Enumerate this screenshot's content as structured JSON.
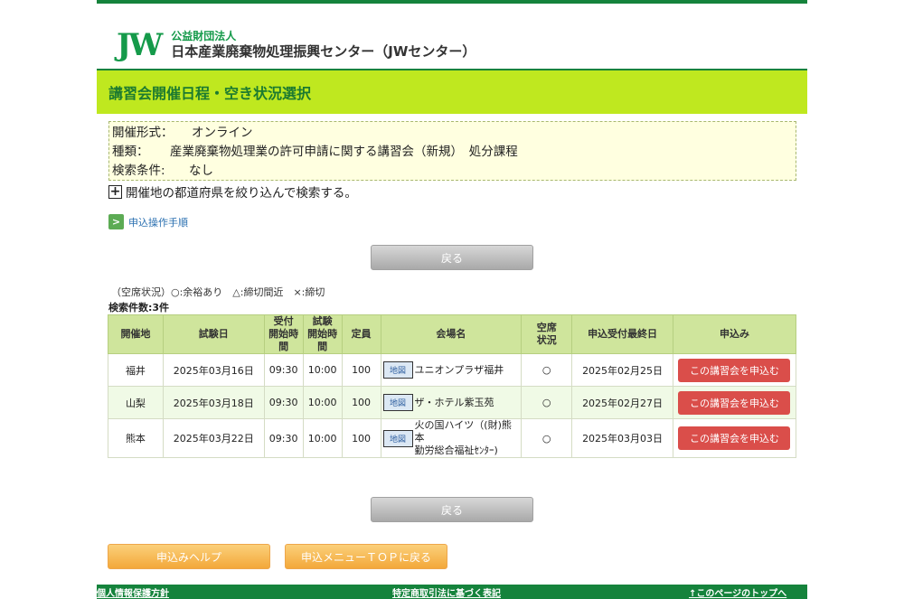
{
  "header": {
    "logo_mark": "JW",
    "logo_sub": "公益財団法人",
    "logo_main": "日本産業廃棄物処理振興センター（JWセンター）",
    "page_title": "講習会開催日程・空き状況選択"
  },
  "info": {
    "format_label": "開催形式：",
    "format_value": "オンライン",
    "type_label": "種類：",
    "type_value": "産業廃棄物処理業の許可申請に関する講習会（新規）　処分課程",
    "search_label": "検索条件:",
    "search_value": "なし"
  },
  "expand_label": "開催地の都道府県を絞り込んで検索する。",
  "help_link": "申込操作手順",
  "back_label": "戻る",
  "legend": "（空席状況）○:余裕あり　△:締切間近　×:締切",
  "result_count": "検索件数:3件",
  "table": {
    "headers": {
      "place": "開催地",
      "date": "試験日",
      "reception_l1": "受付",
      "reception_l2": "開始時間",
      "exam_l1": "試験",
      "exam_l2": "開始時間",
      "capacity": "定員",
      "venue": "会場名",
      "vacancy_l1": "空席",
      "vacancy_l2": "状況",
      "deadline": "申込受付最終日",
      "apply": "申込み"
    },
    "map_label": "地図",
    "apply_label": "この講習会を申込む",
    "rows": [
      {
        "place": "福井",
        "date": "2025年03月16日",
        "reception": "09:30",
        "exam": "10:00",
        "capacity": "100",
        "venue_l1": "ユニオンプラザ福井",
        "venue_l2": "",
        "vacancy": "○",
        "deadline": "2025年02月25日"
      },
      {
        "place": "山梨",
        "date": "2025年03月18日",
        "reception": "09:30",
        "exam": "10:00",
        "capacity": "100",
        "venue_l1": "ザ・ホテル紫玉苑",
        "venue_l2": "",
        "vacancy": "○",
        "deadline": "2025年02月27日"
      },
      {
        "place": "熊本",
        "date": "2025年03月22日",
        "reception": "09:30",
        "exam": "10:00",
        "capacity": "100",
        "venue_l1": "火の国ハイツ（(財)熊本",
        "venue_l2": "勤労総合福祉ｾﾝﾀｰ)",
        "vacancy": "○",
        "deadline": "2025年03月03日"
      }
    ]
  },
  "buttons": {
    "help": "申込みヘルプ",
    "menu_top": "申込メニューＴＯＰに戻る"
  },
  "footer": {
    "privacy": "個人情報保護方針",
    "commerce": "特定商取引法に基づく表記",
    "page_top": "↑このページのトップへ"
  }
}
